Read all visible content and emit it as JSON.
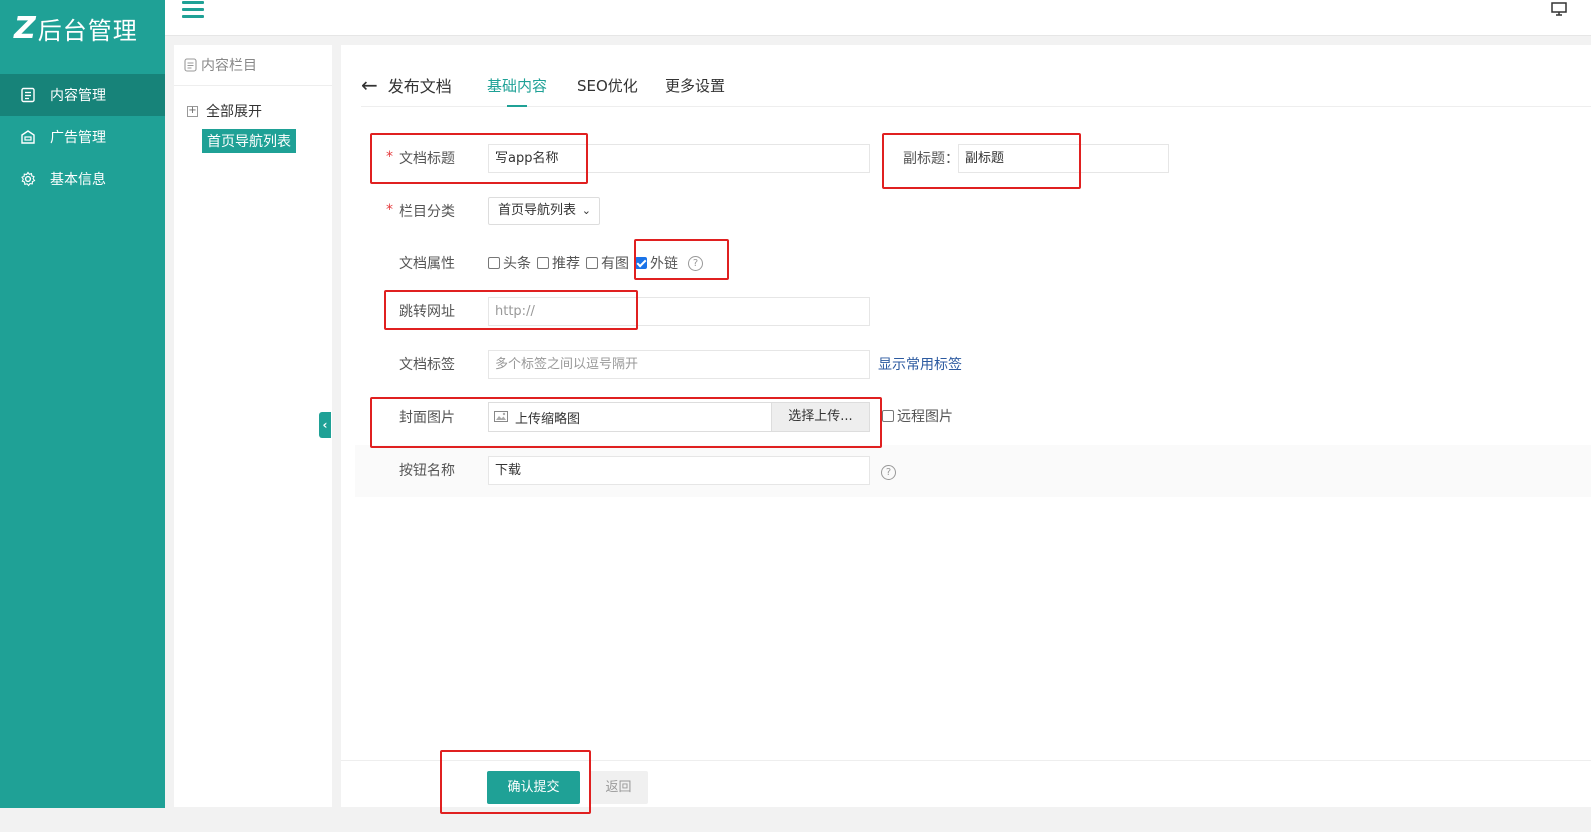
{
  "app": {
    "logo_mark": "Z",
    "title": "后台管理"
  },
  "sidebar": {
    "items": [
      {
        "label": "内容管理",
        "icon": "document-icon",
        "active": true
      },
      {
        "label": "广告管理",
        "icon": "ad-icon",
        "active": false
      },
      {
        "label": "基本信息",
        "icon": "gear-icon",
        "active": false
      }
    ]
  },
  "tree": {
    "header": "内容栏目",
    "expand_label": "全部展开",
    "expand_symbol": "+",
    "selected_node": "首页导航列表",
    "collapse_symbol": "‹"
  },
  "tabs": {
    "back_label": "发布文档",
    "back_symbol": "←",
    "items": [
      "基础内容",
      "SEO优化",
      "更多设置"
    ],
    "active": "基础内容"
  },
  "form": {
    "required_mark": "*",
    "title": {
      "label": "文档标题",
      "value": "写app名称"
    },
    "subtitle": {
      "label": "副标题：",
      "value": "副标题"
    },
    "category": {
      "label": "栏目分类",
      "value": "首页导航列表",
      "chevron": "⌄"
    },
    "attributes": {
      "label": "文档属性",
      "options": [
        {
          "label": "头条",
          "checked": false
        },
        {
          "label": "推荐",
          "checked": false
        },
        {
          "label": "有图",
          "checked": false
        },
        {
          "label": "外链",
          "checked": true
        }
      ],
      "help": "?"
    },
    "redirect_url": {
      "label": "跳转网址",
      "placeholder": "http://"
    },
    "tags": {
      "label": "文档标签",
      "placeholder": "多个标签之间以逗号隔开",
      "link": "显示常用标签"
    },
    "cover": {
      "label": "封面图片",
      "upload_text": "上传缩略图",
      "button": "选择上传...",
      "remote_label": "远程图片",
      "remote_checked": false
    },
    "button_name": {
      "label": "按钮名称",
      "value": "下载",
      "help": "?"
    }
  },
  "footer": {
    "submit": "确认提交",
    "back": "返回"
  },
  "colors": {
    "primary": "#1fa196",
    "primary_dark": "#178379",
    "highlight": "#e02020",
    "link": "#2c5aa0"
  }
}
